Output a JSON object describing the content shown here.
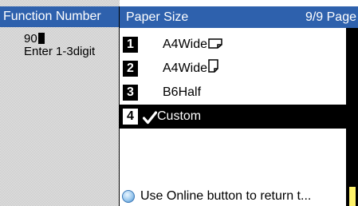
{
  "background_panel": {
    "header": "Function Number",
    "value": "90",
    "hint": "Enter 1-3digit"
  },
  "dialog": {
    "title": "Paper Size",
    "page_indicator": "9/9 Page",
    "items": [
      {
        "number": "1",
        "label": "A4Wide",
        "orientation_icon": "landscape-page-icon",
        "selected": false
      },
      {
        "number": "2",
        "label": "A4Wide",
        "orientation_icon": "portrait-page-icon",
        "selected": false
      },
      {
        "number": "3",
        "label": "B6Half",
        "selected": false
      },
      {
        "number": "4",
        "label": "Custom",
        "selected": true,
        "check_icon": "checkmark-icon"
      }
    ],
    "footer": {
      "icon": "online-button-icon",
      "text": "Use Online button to return t..."
    }
  },
  "colors": {
    "header_bg": "#2e61ad",
    "header_text": "#ffffff",
    "selected_bg": "#000000",
    "scroll_thumb": "#fff36a"
  }
}
